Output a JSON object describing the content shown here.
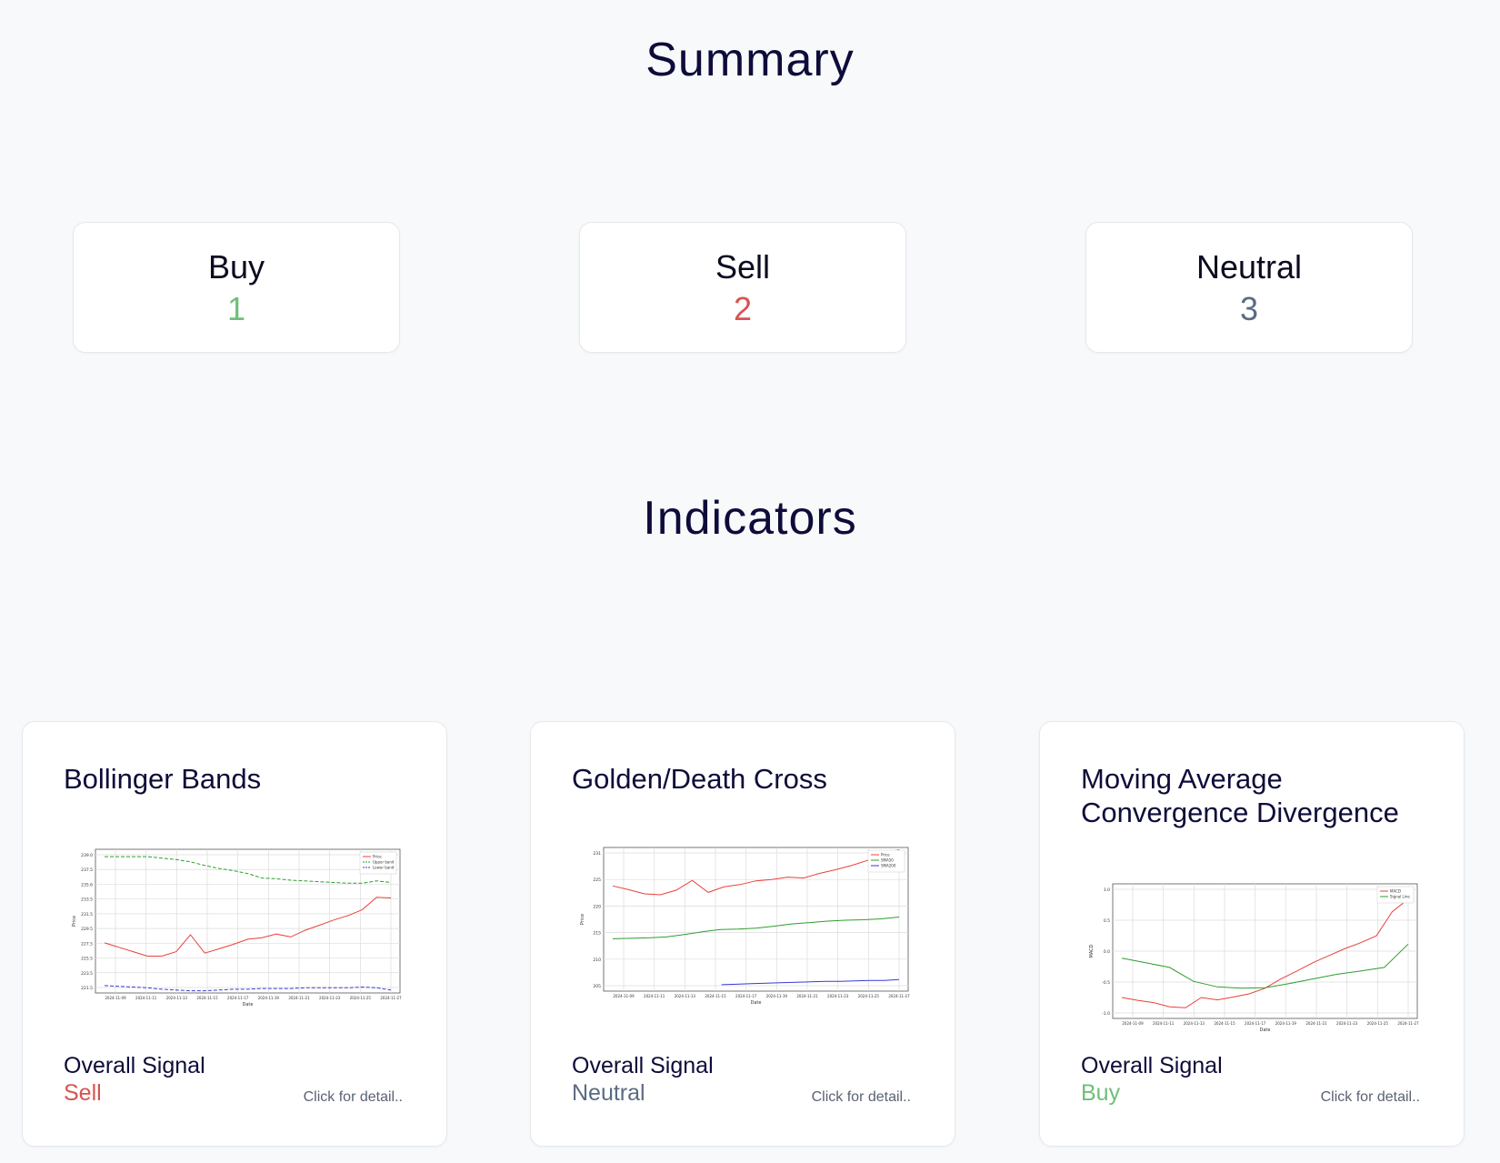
{
  "summary": {
    "title": "Summary",
    "cards": [
      {
        "label": "Buy",
        "count": "1",
        "color": "#6fbf7a"
      },
      {
        "label": "Sell",
        "count": "2",
        "color": "#d9534f"
      },
      {
        "label": "Neutral",
        "count": "3",
        "color": "#5b6b82"
      }
    ]
  },
  "indicators": {
    "title": "Indicators",
    "signal_label": "Overall Signal",
    "detail_link": "Click for detail..",
    "colors": {
      "sell": "#d9534f",
      "neutral": "#5b6b82",
      "buy": "#6fbf7a"
    },
    "cards": [
      {
        "title": "Bollinger Bands",
        "signal": "Sell",
        "signal_key": "sell"
      },
      {
        "title": "Golden/Death Cross",
        "signal": "Neutral",
        "signal_key": "neutral"
      },
      {
        "title": "Moving Average Convergence Divergence",
        "signal": "Buy",
        "signal_key": "buy"
      }
    ]
  },
  "chart_data": [
    {
      "type": "line",
      "title": "",
      "xlabel": "Date",
      "ylabel": "Price",
      "x_ticks": [
        "2024-11-09",
        "2024-11-11",
        "2024-11-13",
        "2024-11-15",
        "2024-11-17",
        "2024-11-19",
        "2024-11-21",
        "2024-11-23",
        "2024-11-25",
        "2024-11-27"
      ],
      "y_ticks": [
        "239.0",
        "237.5",
        "235.6",
        "233.5",
        "231.5",
        "229.5",
        "227.5",
        "225.5",
        "223.5",
        "221.5"
      ],
      "ylim": [
        220.5,
        240.0
      ],
      "x": [
        0,
        1,
        2,
        3,
        4,
        5,
        6,
        7,
        8,
        9,
        10,
        11,
        12,
        13,
        14,
        15,
        16,
        17,
        18,
        19,
        20,
        21,
        22,
        23,
        24,
        25,
        26,
        27
      ],
      "series": [
        {
          "name": "Price",
          "color": "#e8413b",
          "dash": "",
          "values": [
            227.3,
            226.7,
            226.1,
            225.5,
            225.5,
            226.1,
            228.4,
            225.9,
            226.5,
            227.1,
            227.8,
            228.0,
            228.5,
            228.1,
            229.0,
            229.7,
            230.4,
            231.0,
            231.8,
            233.5,
            233.4
          ]
        },
        {
          "name": "Upper band",
          "color": "#2e9e2e",
          "dash": "4,2",
          "values": [
            239.0,
            239.0,
            239.0,
            239.0,
            238.8,
            238.6,
            238.3,
            237.8,
            237.4,
            237.1,
            236.7,
            236.1,
            236.0,
            235.8,
            235.7,
            235.6,
            235.5,
            235.4,
            235.4,
            235.7,
            235.5
          ]
        },
        {
          "name": "Lower band",
          "color": "#3a3ad8",
          "dash": "4,2",
          "values": [
            221.5,
            221.4,
            221.3,
            221.2,
            221.0,
            220.9,
            220.8,
            220.8,
            220.9,
            221.0,
            221.0,
            221.1,
            221.1,
            221.1,
            221.2,
            221.2,
            221.2,
            221.2,
            221.3,
            221.2,
            220.9
          ]
        }
      ],
      "legend": "top-right",
      "grid": true
    },
    {
      "type": "line",
      "title": "",
      "xlabel": "Date",
      "ylabel": "Price",
      "x_ticks": [
        "2024-11-09",
        "2024-11-11",
        "2024-11-13",
        "2024-11-15",
        "2024-11-17",
        "2024-11-19",
        "2024-11-21",
        "2024-11-23",
        "2024-11-25",
        "2024-11-27"
      ],
      "y_ticks": [
        "231",
        "225",
        "220",
        "215",
        "210",
        "205"
      ],
      "ylim": [
        203,
        234
      ],
      "series": [
        {
          "name": "Price",
          "color": "#e8413b",
          "values": [
            225.7,
            224.9,
            224.0,
            223.8,
            224.8,
            226.9,
            224.3,
            225.5,
            226.0,
            226.8,
            227.1,
            227.6,
            227.4,
            228.4,
            229.2,
            230.1,
            231.2,
            232.8,
            233.5
          ]
        },
        {
          "name": "SMA50",
          "color": "#2e9e2e",
          "values": [
            214.3,
            214.4,
            214.5,
            214.7,
            215.2,
            215.8,
            216.3,
            216.4,
            216.6,
            217.0,
            217.5,
            217.8,
            218.1,
            218.3,
            218.4,
            218.6,
            219.0
          ]
        },
        {
          "name": "SMA200",
          "color": "#3a3ad8",
          "values": [
            204.4,
            204.5,
            204.6,
            204.7,
            204.8,
            204.9,
            205.0,
            205.1,
            205.1,
            205.2,
            205.3,
            205.3,
            205.5
          ]
        }
      ],
      "legend": "top-right",
      "grid": true
    },
    {
      "type": "line",
      "title": "",
      "xlabel": "Date",
      "ylabel": "MACD",
      "x_ticks": [
        "2024-11-09",
        "2024-11-11",
        "2024-11-13",
        "2024-11-15",
        "2024-11-17",
        "2024-11-19",
        "2024-11-21",
        "2024-11-23",
        "2024-11-25",
        "2024-11-27"
      ],
      "y_ticks": [
        "1.0",
        "0.5",
        "0.0",
        "-0.5",
        "-1.0"
      ],
      "ylim": [
        -1.3,
        1.6
      ],
      "series": [
        {
          "name": "MACD",
          "color": "#e8413b",
          "values": [
            -0.85,
            -0.91,
            -0.96,
            -1.05,
            -1.07,
            -0.85,
            -0.9,
            -0.84,
            -0.77,
            -0.65,
            -0.45,
            -0.28,
            -0.1,
            0.05,
            0.2,
            0.33,
            0.48,
            1.0,
            1.27
          ]
        },
        {
          "name": "Signal Line",
          "color": "#2e9e2e",
          "values": [
            0.0,
            -0.1,
            -0.2,
            -0.5,
            -0.62,
            -0.65,
            -0.64,
            -0.55,
            -0.45,
            -0.35,
            -0.28,
            -0.2,
            0.3
          ]
        }
      ],
      "legend": "top-right",
      "grid": true
    }
  ]
}
